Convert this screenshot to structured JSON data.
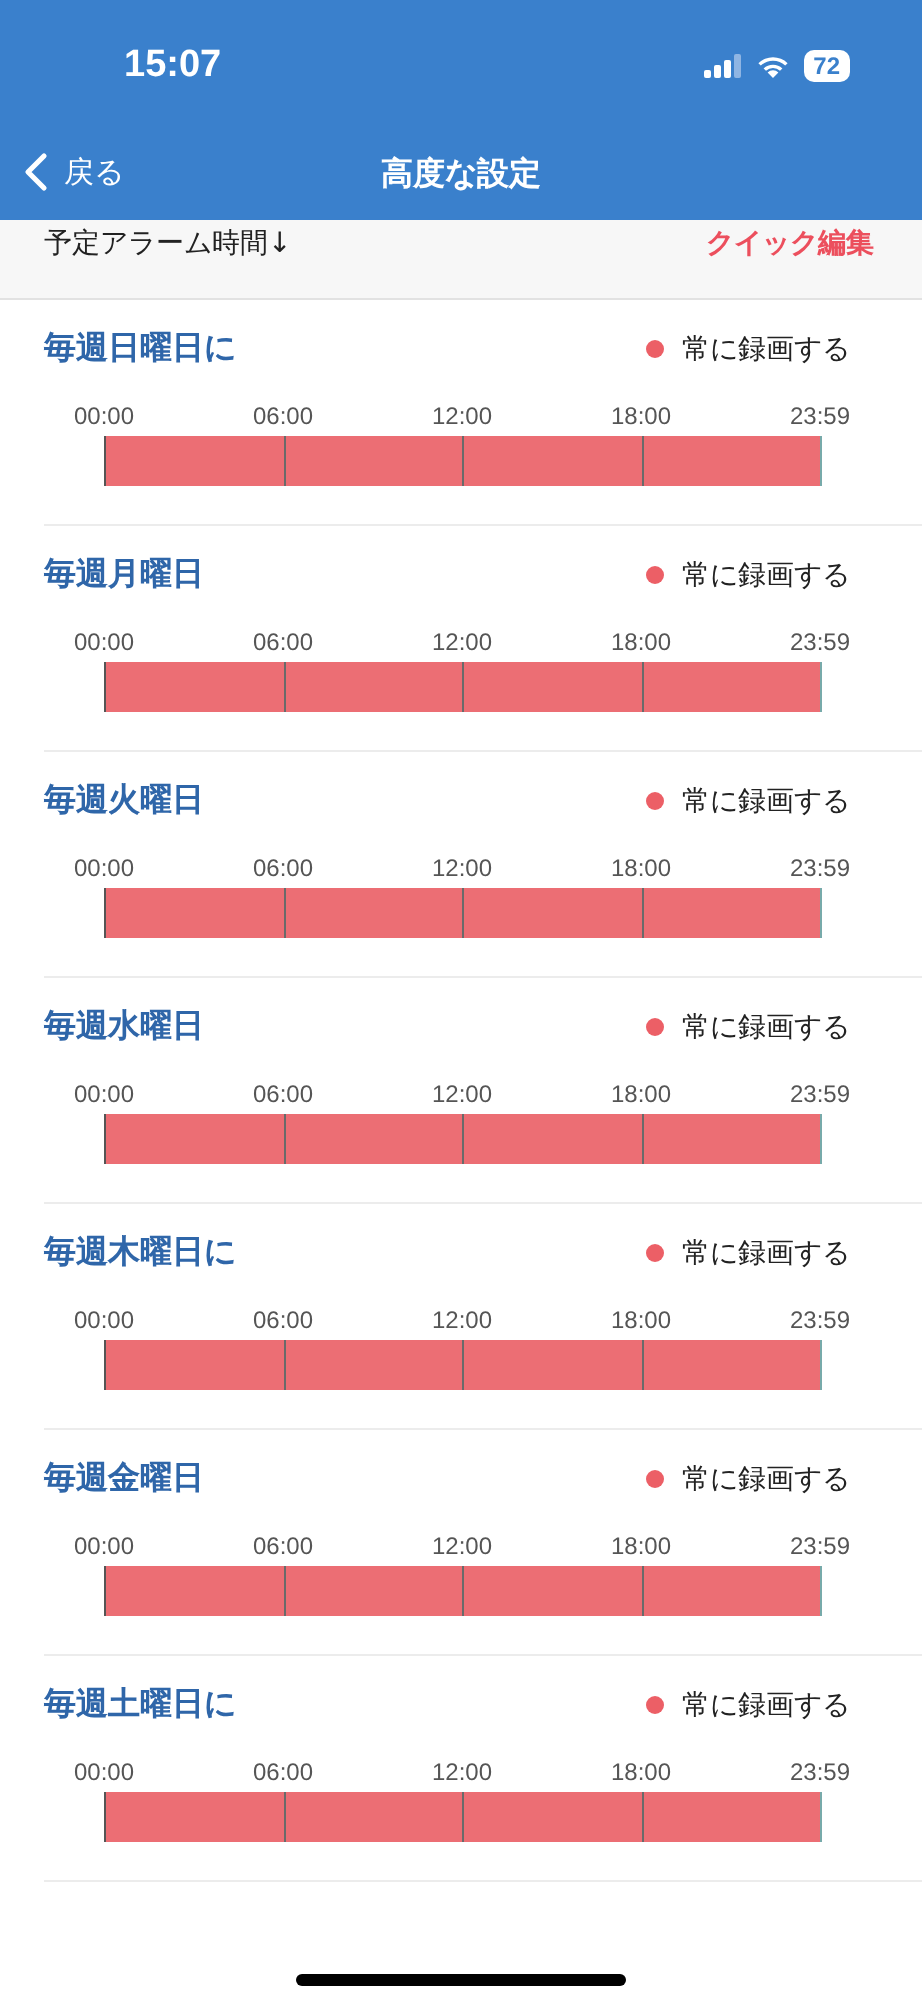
{
  "status_bar": {
    "time": "15:07",
    "battery": "72"
  },
  "nav": {
    "back": "戻る",
    "title": "高度な設定"
  },
  "header": {
    "sort_label": "予定アラーム時間↓",
    "quick_edit": "クイック編集"
  },
  "days": [
    {
      "title": "毎週日曜日に",
      "legend": "常に録画する",
      "ticks": [
        "00:00",
        "06:00",
        "12:00",
        "18:00",
        "23:59"
      ]
    },
    {
      "title": "毎週月曜日",
      "legend": "常に録画する",
      "ticks": [
        "00:00",
        "06:00",
        "12:00",
        "18:00",
        "23:59"
      ]
    },
    {
      "title": "毎週火曜日",
      "legend": "常に録画する",
      "ticks": [
        "00:00",
        "06:00",
        "12:00",
        "18:00",
        "23:59"
      ]
    },
    {
      "title": "毎週水曜日",
      "legend": "常に録画する",
      "ticks": [
        "00:00",
        "06:00",
        "12:00",
        "18:00",
        "23:59"
      ]
    },
    {
      "title": "毎週木曜日に",
      "legend": "常に録画する",
      "ticks": [
        "00:00",
        "06:00",
        "12:00",
        "18:00",
        "23:59"
      ]
    },
    {
      "title": "毎週金曜日",
      "legend": "常に録画する",
      "ticks": [
        "00:00",
        "06:00",
        "12:00",
        "18:00",
        "23:59"
      ]
    },
    {
      "title": "毎週土曜日に",
      "legend": "常に録画する",
      "ticks": [
        "00:00",
        "06:00",
        "12:00",
        "18:00",
        "23:59"
      ]
    }
  ]
}
